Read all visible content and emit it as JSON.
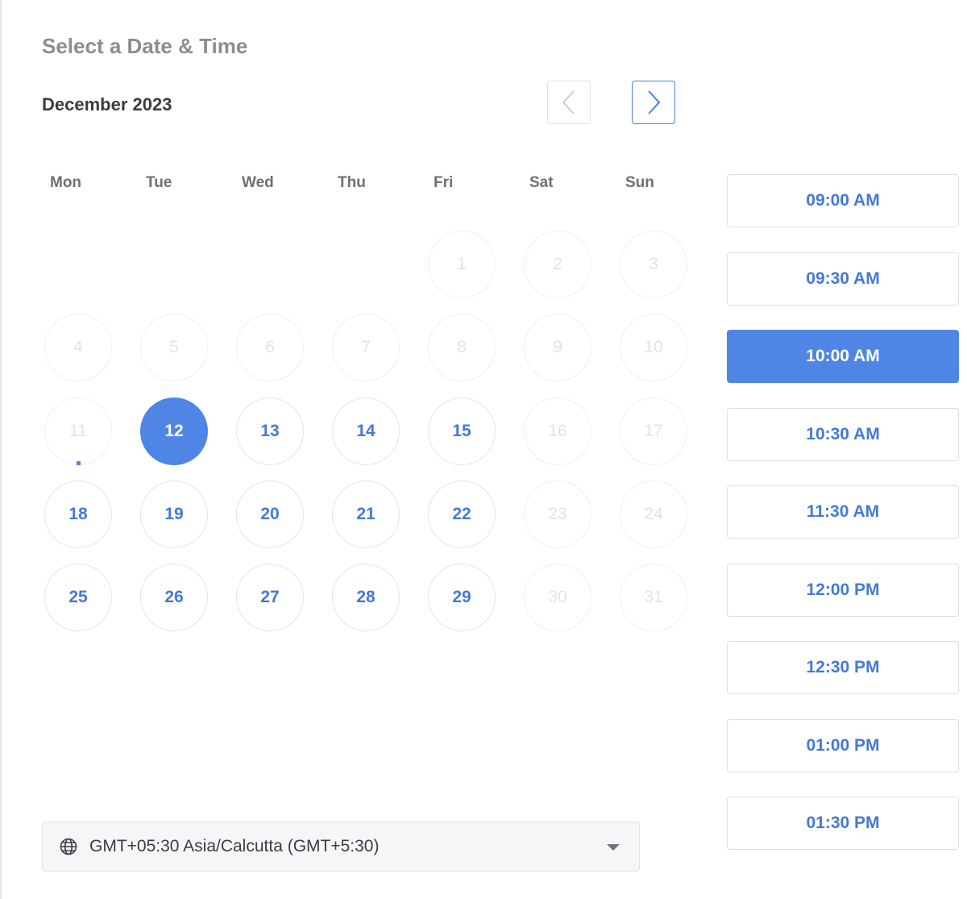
{
  "header": {
    "title": "Select a Date & Time",
    "month_label": "December 2023"
  },
  "calendar": {
    "weekdays": [
      "Mon",
      "Tue",
      "Wed",
      "Thu",
      "Fri",
      "Sat",
      "Sun"
    ],
    "first_weekday_index": 4,
    "days_in_month": 31,
    "selected_day": 12,
    "today_day": 11,
    "available_days": [
      12,
      13,
      14,
      15,
      18,
      19,
      20,
      21,
      22,
      25,
      26,
      27,
      28,
      29
    ]
  },
  "time_slots": {
    "items": [
      "09:00 AM",
      "09:30 AM",
      "10:00 AM",
      "10:30 AM",
      "11:30 AM",
      "12:00 PM",
      "12:30 PM",
      "01:00 PM",
      "01:30 PM"
    ],
    "selected_index": 2
  },
  "timezone": {
    "label": "GMT+05:30 Asia/Calcutta (GMT+5:30)",
    "icon": "globe-icon"
  },
  "colors": {
    "accent": "#4f86e5",
    "available_text": "#4479d8",
    "disabled_text": "#e1e3e6"
  }
}
